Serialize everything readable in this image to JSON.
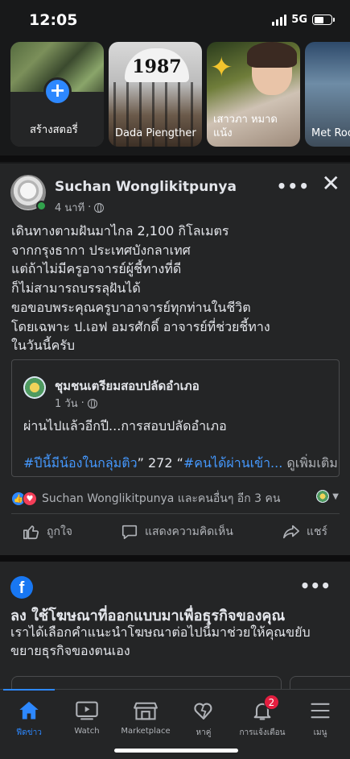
{
  "status": {
    "time": "12:05",
    "network": "5G",
    "battery_level": 0.55
  },
  "stories": [
    {
      "label": "สร้างสตอรี่"
    },
    {
      "label": "Dada Piengther",
      "plate_text": "1987"
    },
    {
      "label": "เสาวภา หมาดแน้ง"
    },
    {
      "label": "Met Roo"
    }
  ],
  "post": {
    "author": "Suchan Wonglikitpunya",
    "time": "4 นาที",
    "text_lines": [
      "เดินทางตามฝันมาไกล 2,100 กิโลเมตร",
      "จากกรุงธากา ประเทศบังกลาเทศ",
      "แต่ถ้าไม่มีครูอาจารย์ผู้ชี้ทางที่ดี",
      "ก็ไม่สามารถบรรลุฝันได้",
      "ขอขอบพระคุณครูบาอาจารย์ทุกท่านในชีวิต",
      "โดยเฉพาะ ป.เอฟ อมรศักดิ์ อาจารย์ที่ช่วยชี้ทาง",
      "ในวันนี้ครับ"
    ],
    "shared": {
      "title": "ชุมชนเตรียมสอบปลัดอำเภอ",
      "time": "1 วัน",
      "text": "ผ่านไปแล้วอีกปี...การสอบปลัดอำเภอ",
      "hashtag1": "#ปีนี้มีน้องในกลุ่มติว",
      "mid": "” 272 “",
      "hashtag2": "#คนได้ผ่านเข้า...",
      "see_more": " ดูเพิ่มเติม"
    },
    "reactions_text": "Suchan Wonglikitpunya และคนอื่นๆ อีก 3 คน",
    "actions": {
      "like": "ถูกใจ",
      "comment": "แสดงความคิดเห็น",
      "share": "แชร์"
    }
  },
  "ad": {
    "title": "ลง ใช้โฆษณาที่ออกแบบมาเพื่อธุรกิจของคุณ",
    "desc": "เราได้เลือกคำแนะนำโฆษณาต่อไปนี้มาช่วยให้คุณขยับขยายธุรกิจของตนเอง"
  },
  "tabs": [
    {
      "label": "ฟีดข่าว",
      "icon": "home-icon",
      "active": true
    },
    {
      "label": "Watch",
      "icon": "video-icon"
    },
    {
      "label": "Marketplace",
      "icon": "marketplace-icon"
    },
    {
      "label": "หาคู่",
      "icon": "dating-heart-icon"
    },
    {
      "label": "การแจ้งเตือน",
      "icon": "bell-icon",
      "badge": "2"
    },
    {
      "label": "เมนู",
      "icon": "menu-icon"
    }
  ],
  "colors": {
    "accent": "#2d88ff",
    "background": "#18191a",
    "card": "#242526",
    "badge": "#e41e3f"
  }
}
